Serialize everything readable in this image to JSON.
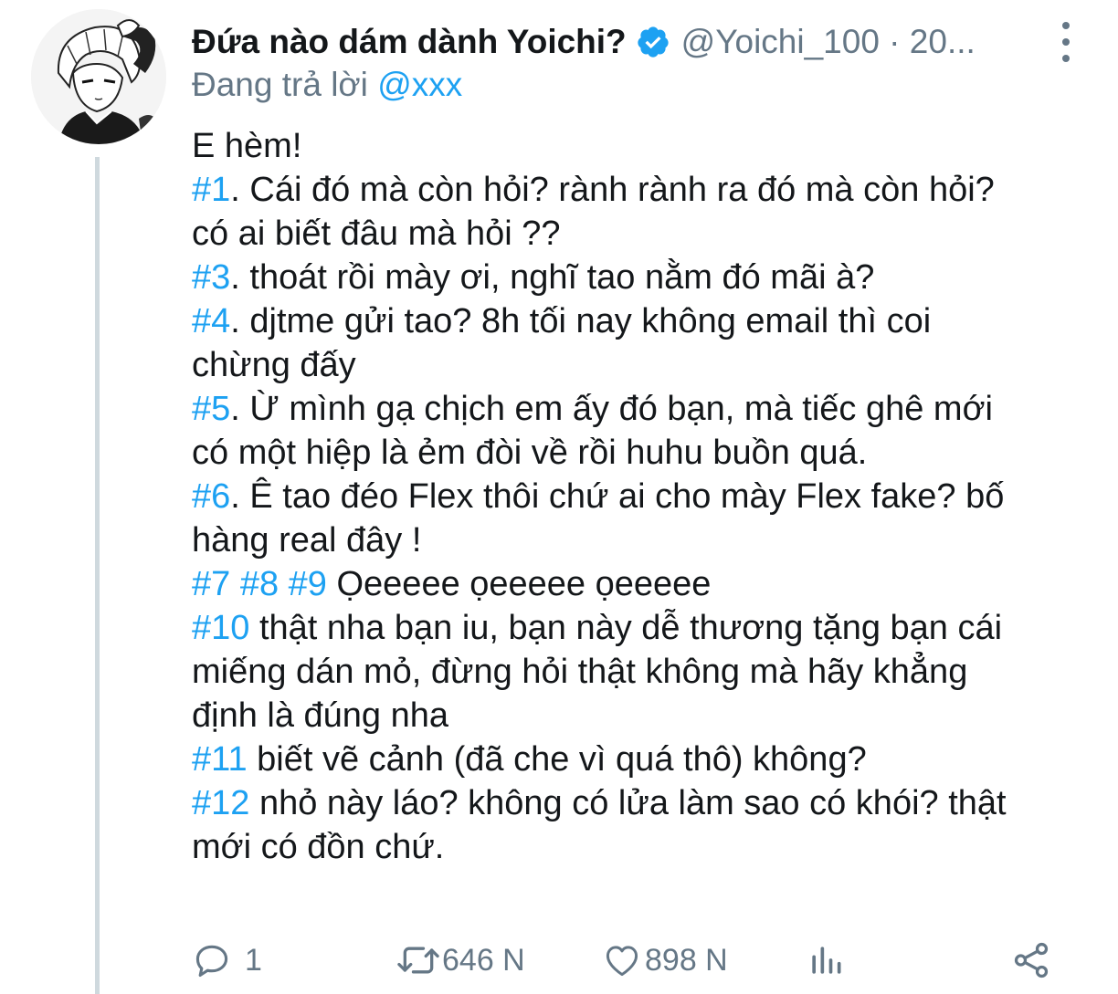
{
  "tweet": {
    "display_name": "Đứa nào dám dành Yoichi?",
    "handle": "@Yoichi_100 · 20...",
    "reply_prefix": "Đang trả lời",
    "reply_mention": "@xxx",
    "lines": [
      {
        "tag": "",
        "text": "E hèm!"
      },
      {
        "tag": "#1",
        "text": ". Cái đó mà còn hỏi? rành rành ra đó mà còn hỏi?"
      },
      {
        "tag": "",
        "text": "có ai biết đâu mà hỏi ??"
      },
      {
        "tag": "#3",
        "text": ". thoát rồi mày ơi, nghĩ tao nằm đó mãi à?"
      },
      {
        "tag": "#4",
        "text": ". djtme gửi tao? 8h tối nay không email thì coi"
      },
      {
        "tag": "",
        "text": "chừng đấy"
      },
      {
        "tag": "#5",
        "text": ". Ừ mình gạ chịch em ấy đó bạn, mà tiếc ghê mới"
      },
      {
        "tag": "",
        "text": "có một hiệp là ẻm đòi về rồi huhu buồn quá."
      },
      {
        "tag": "#6",
        "text": ". Ê tao đéo Flex thôi chứ ai cho mày Flex fake? bố"
      },
      {
        "tag": "",
        "text": "hàng real đây !"
      },
      {
        "tag": "#7 #8 #9",
        "text": " Ọeeeee ọeeeee ọeeeee"
      },
      {
        "tag": "#10",
        "text": " thật nha bạn iu, bạn này dễ thương tặng bạn cái"
      },
      {
        "tag": "",
        "text": "miếng dán mỏ, đừng hỏi thật không mà hãy khẳng"
      },
      {
        "tag": "",
        "text": "định là đúng nha"
      },
      {
        "tag": "#11",
        "text": " biết vẽ cảnh (đã che vì quá thô) không?"
      },
      {
        "tag": "#12",
        "text": " nhỏ này láo? không có lửa làm sao có khói? thật"
      },
      {
        "tag": "",
        "text": "mới có đồn chứ."
      }
    ]
  },
  "actions": {
    "reply_count": "1",
    "retweet_count": "646 N",
    "like_count": "898 N"
  },
  "colors": {
    "link": "#1da1f2",
    "secondary": "#657786",
    "text": "#14171a",
    "thread_line": "#cfd9de"
  },
  "icons": [
    "verified-badge-icon",
    "more-options-icon",
    "reply-icon",
    "retweet-icon",
    "like-icon",
    "analytics-icon",
    "share-icon"
  ]
}
